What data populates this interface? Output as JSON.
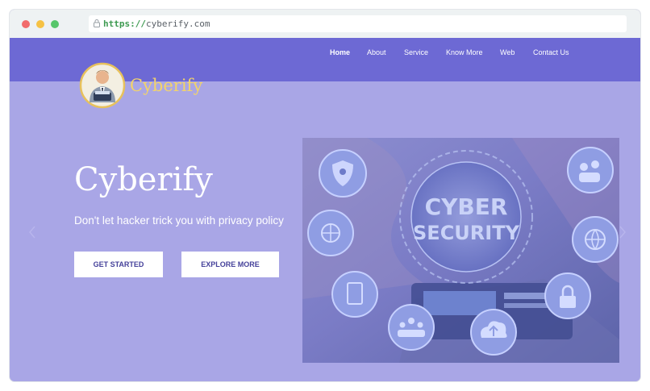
{
  "browser": {
    "url_scheme": "https://",
    "url_host": "cyberify.com"
  },
  "nav": {
    "items": [
      {
        "label": "Home",
        "active": true
      },
      {
        "label": "About"
      },
      {
        "label": "Service"
      },
      {
        "label": "Know More"
      },
      {
        "label": "Web"
      },
      {
        "label": "Contact Us"
      }
    ]
  },
  "logo": {
    "text": "Cyberify"
  },
  "hero": {
    "title": "Cyberify",
    "subtitle": "Don't let hacker trick you with privacy policy",
    "get_started_label": "GET STARTED",
    "explore_more_label": "EXPLORE MORE",
    "image_text_line1": "CYBER",
    "image_text_line2": "SECURITY",
    "image_icons": [
      "shield-lock-icon",
      "users-icon",
      "cloud-globe-icon",
      "globe-icon",
      "tablet-icon",
      "padlock-icon",
      "people-icon",
      "cloud-upload-icon"
    ]
  },
  "colors": {
    "nav_bg": "#6d69d4",
    "hero_bg": "#a9a6e6",
    "logo_text": "#f2d36a",
    "button_text": "#45419a"
  }
}
